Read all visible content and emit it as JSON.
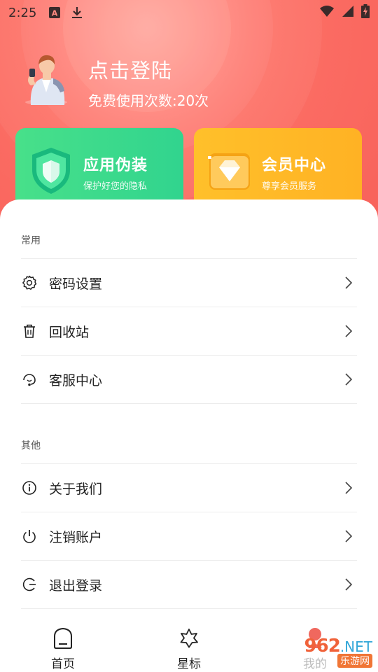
{
  "status_bar": {
    "time": "2:25",
    "icons": [
      "font-notification-icon",
      "download-icon",
      "wifi-icon",
      "signal-icon",
      "battery-charging-icon"
    ]
  },
  "header": {
    "login_prompt": "点击登陆",
    "usage_text": "免费使用次数:20次"
  },
  "cards": [
    {
      "title": "应用伪装",
      "subtitle": "保护好您的隐私",
      "icon": "shield-icon",
      "color": "#3ad98c"
    },
    {
      "title": "会员中心",
      "subtitle": "尊享会员服务",
      "icon": "diamond-icon",
      "color": "#ffb826"
    }
  ],
  "sections": {
    "common": {
      "label": "常用",
      "items": [
        {
          "label": "密码设置",
          "icon": "gear-icon"
        },
        {
          "label": "回收站",
          "icon": "trash-icon"
        },
        {
          "label": "客服中心",
          "icon": "headset-icon"
        }
      ]
    },
    "other": {
      "label": "其他",
      "items": [
        {
          "label": "关于我们",
          "icon": "info-icon"
        },
        {
          "label": "注销账户",
          "icon": "power-icon"
        },
        {
          "label": "退出登录",
          "icon": "logout-icon"
        }
      ]
    }
  },
  "bottom_nav": {
    "tabs": [
      {
        "label": "首页",
        "icon": "home-icon"
      },
      {
        "label": "星标",
        "icon": "star-icon"
      },
      {
        "label": "我的",
        "icon": "profile-icon"
      }
    ]
  },
  "watermark": {
    "number": "962",
    "domain": ".NET",
    "sub": "乐游网"
  },
  "colors": {
    "accent": "#f8645c",
    "green": "#3ad98c",
    "orange": "#ffb826"
  }
}
